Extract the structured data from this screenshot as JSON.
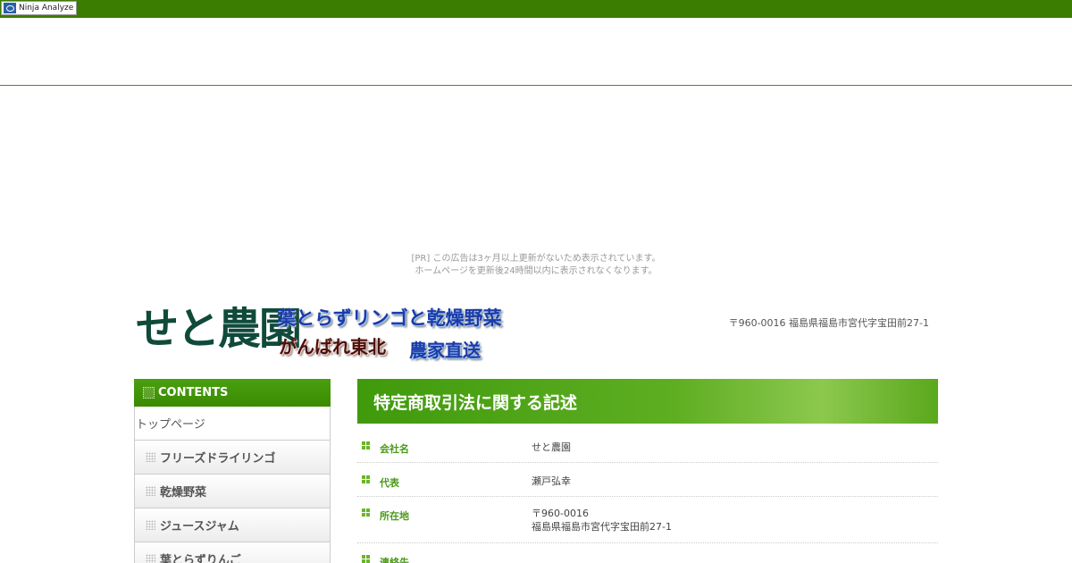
{
  "ninja": {
    "label": "Ninja Analyze"
  },
  "ad": {
    "line1": "[PR] この広告は3ヶ月以上更新がないため表示されています。",
    "line2": "ホームページを更新後24時間以内に表示されなくなります。"
  },
  "header": {
    "brand": "せと農園",
    "tag1": "葉とらずリンゴと乾燥野菜",
    "tag2": "がんばれ東北",
    "tag3": "農家直送",
    "address": "〒960-0016 福島県福島市宮代字宝田前27-1"
  },
  "sidebar": {
    "title": "CONTENTS",
    "top": "トップページ",
    "items": [
      {
        "label": "フリーズドライリンゴ"
      },
      {
        "label": "乾燥野菜"
      },
      {
        "label": "ジュースジャム"
      },
      {
        "label": "葉とらずりんご"
      }
    ]
  },
  "main": {
    "title": "特定商取引法に関する記述",
    "rows": [
      {
        "label": "会社名",
        "value": "せと農園"
      },
      {
        "label": "代表",
        "value": "瀬戸弘幸"
      },
      {
        "label": "所在地",
        "value": "〒960-0016",
        "value2": "福島県福島市宮代字宝田前27-1"
      },
      {
        "label": "連絡先",
        "value": ""
      }
    ]
  },
  "colors": {
    "accent": "#3b7d00",
    "label": "#4a9a18"
  }
}
